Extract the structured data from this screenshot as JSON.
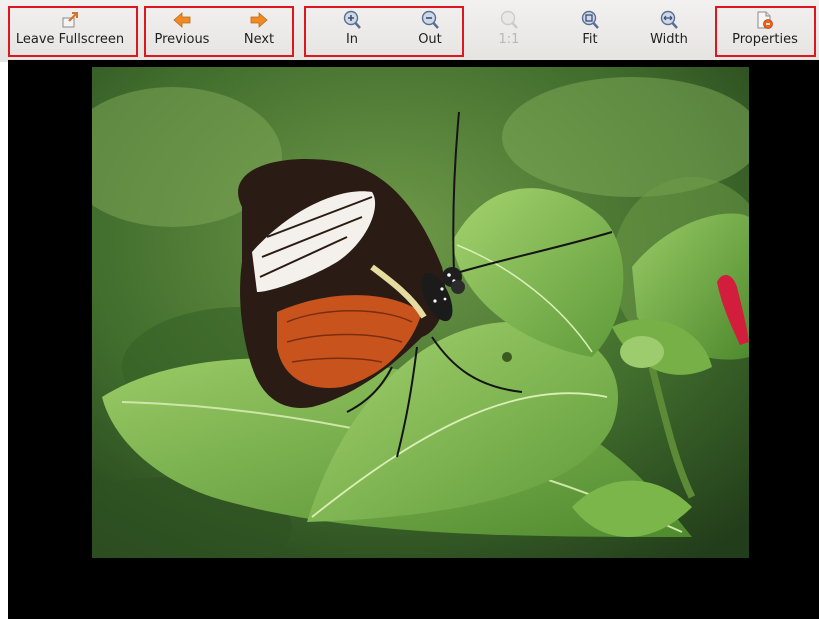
{
  "toolbar": {
    "leave_fullscreen": {
      "label": "Leave Fullscreen",
      "icon": "leave-fullscreen-icon",
      "enabled": true
    },
    "previous": {
      "label": "Previous",
      "icon": "arrow-left-icon",
      "enabled": true
    },
    "next": {
      "label": "Next",
      "icon": "arrow-right-icon",
      "enabled": true
    },
    "zoom_in": {
      "label": "In",
      "icon": "zoom-in-icon",
      "enabled": true
    },
    "zoom_out": {
      "label": "Out",
      "icon": "zoom-out-icon",
      "enabled": true
    },
    "zoom_1to1": {
      "label": "1:1",
      "icon": "zoom-original-icon",
      "enabled": false
    },
    "zoom_fit": {
      "label": "Fit",
      "icon": "zoom-fit-icon",
      "enabled": true
    },
    "zoom_width": {
      "label": "Width",
      "icon": "zoom-width-icon",
      "enabled": true
    },
    "properties": {
      "label": "Properties",
      "icon": "properties-icon",
      "enabled": true
    }
  },
  "viewer": {
    "background_color": "#000000",
    "image_subject": "butterfly-photo"
  },
  "colors": {
    "highlight_border": "#e0161e",
    "toolbar_bg": "#ebe9e6"
  }
}
